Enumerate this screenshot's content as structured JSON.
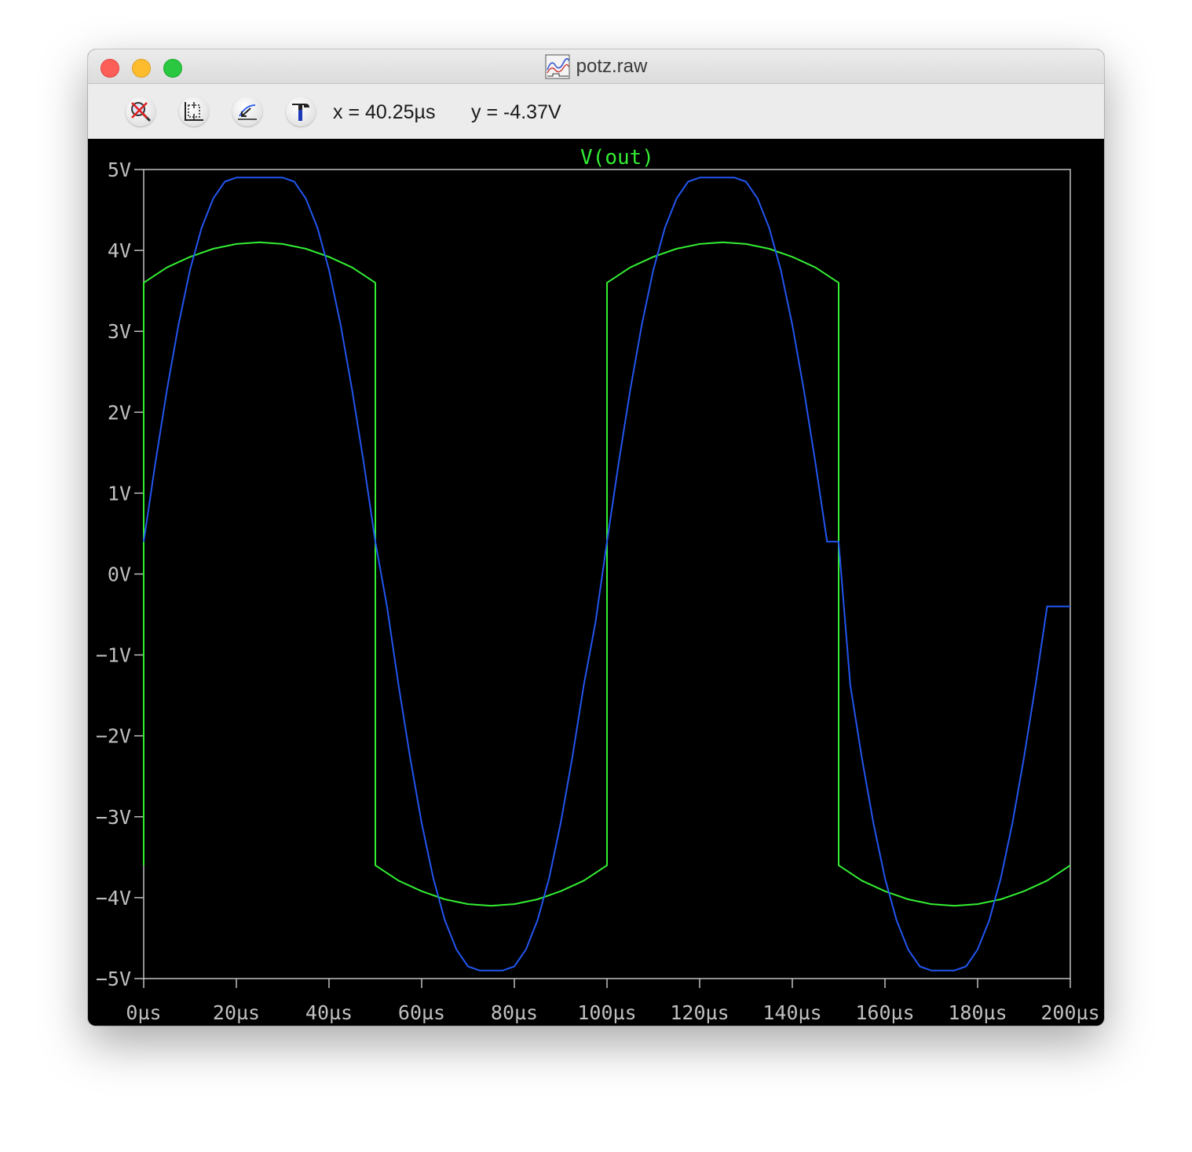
{
  "window": {
    "title": "potz.raw"
  },
  "toolbar": {
    "buttons": [
      {
        "name": "zoom-cancel-button",
        "icon": "zoom-cancel-icon"
      },
      {
        "name": "autorange-button",
        "icon": "autorange-icon"
      },
      {
        "name": "zoom-back-button",
        "icon": "zoom-back-icon"
      },
      {
        "name": "settings-tool-button",
        "icon": "hammer-tool-icon"
      }
    ],
    "cursor_x": "x = 40.25µs",
    "cursor_y": "y = -4.37V"
  },
  "chart_data": {
    "type": "line",
    "title": "V(out)",
    "background": "#000000",
    "axis_color": "#c0c0c0",
    "xlim": [
      0,
      200
    ],
    "ylim": [
      -5,
      5
    ],
    "x_ticks": [
      0,
      20,
      40,
      60,
      80,
      100,
      120,
      140,
      160,
      180,
      200
    ],
    "x_tick_labels": [
      "0µs",
      "20µs",
      "40µs",
      "60µs",
      "80µs",
      "100µs",
      "120µs",
      "140µs",
      "160µs",
      "180µs",
      "200µs"
    ],
    "y_ticks": [
      5,
      4,
      3,
      2,
      1,
      0,
      -1,
      -2,
      -3,
      -4,
      -5
    ],
    "y_tick_labels": [
      "5V",
      "4V",
      "3V",
      "2V",
      "1V",
      "0V",
      "−1V",
      "−2V",
      "−3V",
      "−4V",
      "−5V"
    ],
    "series": [
      {
        "name": "V(out)",
        "color": "#33ee33",
        "x": [
          0,
          0,
          5,
          10,
          15,
          20,
          25,
          30,
          35,
          40,
          45,
          50,
          50,
          50,
          55,
          60,
          65,
          70,
          75,
          80,
          85,
          90,
          95,
          100,
          100,
          100,
          105,
          110,
          115,
          120,
          125,
          130,
          135,
          140,
          145,
          150,
          150,
          150,
          155,
          160,
          165,
          170,
          175,
          180,
          185,
          190,
          195,
          200
        ],
        "y": [
          -3.6,
          3.6,
          3.79,
          3.92,
          4.02,
          4.08,
          4.1,
          4.08,
          4.02,
          3.92,
          3.79,
          3.6,
          0.4,
          -3.6,
          -3.79,
          -3.92,
          -4.02,
          -4.08,
          -4.1,
          -4.08,
          -4.02,
          -3.92,
          -3.79,
          -3.6,
          0.4,
          3.6,
          3.79,
          3.92,
          4.02,
          4.08,
          4.1,
          4.08,
          4.02,
          3.92,
          3.79,
          3.6,
          0.4,
          -3.6,
          -3.79,
          -3.92,
          -4.02,
          -4.08,
          -4.1,
          -4.08,
          -4.02,
          -3.92,
          -3.79,
          -3.6
        ]
      },
      {
        "name": "",
        "color": "#2255ee",
        "x": [
          0,
          2.5,
          5,
          7.5,
          10,
          12.5,
          15,
          17.5,
          20,
          22.5,
          25,
          27.5,
          30,
          32.5,
          35,
          37.5,
          40,
          42.5,
          45,
          47.5,
          50,
          52.5,
          55,
          57.5,
          60,
          62.5,
          65,
          67.5,
          70,
          72.5,
          75,
          77.5,
          80,
          82.5,
          85,
          87.5,
          90,
          92.5,
          95,
          97.5,
          100,
          102.5,
          105,
          107.5,
          110,
          112.5,
          115,
          117.5,
          120,
          122.5,
          125,
          127.5,
          130,
          132.5,
          135,
          137.5,
          140,
          142.5,
          145,
          147.5,
          150,
          152.5,
          155,
          157.5,
          160,
          162.5,
          165,
          167.5,
          170,
          172.5,
          175,
          177.5,
          180,
          182.5,
          185,
          187.5,
          190,
          192.5,
          195,
          197.5,
          200
        ],
        "y": [
          0.4,
          1.37,
          2.27,
          3.08,
          3.76,
          4.28,
          4.64,
          4.85,
          4.9,
          4.9,
          4.9,
          4.9,
          4.9,
          4.85,
          4.64,
          4.28,
          3.76,
          3.08,
          2.27,
          1.37,
          0.4,
          -0.4,
          -1.37,
          -2.27,
          -3.08,
          -3.76,
          -4.28,
          -4.64,
          -4.85,
          -4.9,
          -4.9,
          -4.9,
          -4.85,
          -4.64,
          -4.28,
          -3.76,
          -3.08,
          -2.27,
          -1.37,
          -0.6,
          0.4,
          1.37,
          2.27,
          3.08,
          3.76,
          4.28,
          4.64,
          4.85,
          4.9,
          4.9,
          4.9,
          4.9,
          4.85,
          4.64,
          4.28,
          3.76,
          3.08,
          2.27,
          1.37,
          0.4,
          0.4,
          -1.37,
          -2.27,
          -3.08,
          -3.76,
          -4.28,
          -4.64,
          -4.85,
          -4.9,
          -4.9,
          -4.9,
          -4.85,
          -4.64,
          -4.28,
          -3.76,
          -3.08,
          -2.27,
          -1.37,
          -0.4,
          -0.4,
          -0.4
        ]
      }
    ]
  }
}
